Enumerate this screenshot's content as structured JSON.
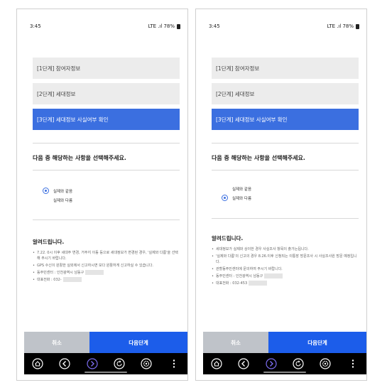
{
  "screens": [
    {
      "id": "left",
      "status": {
        "time": "3:45",
        "signal": "LTE .ıl",
        "battery": "78%"
      },
      "steps": [
        {
          "label": "[1단계] 참여자정보",
          "active": false
        },
        {
          "label": "[2단계] 세대정보",
          "active": false
        },
        {
          "label": "[3단계] 세대정보 사실여부 확인",
          "active": true
        }
      ],
      "question": "다음 중 해당하는 사항을 선택해주세요.",
      "options": [
        {
          "label": "실제와 같음",
          "checked": true
        },
        {
          "label": "실제와 다름",
          "checked": false
        }
      ],
      "notice_title": "알려드립니다.",
      "notice_items": [
        "7.22. 0시 이후 세대주 변경, 거주지 이동 등으로 세대정보가 변경된 경우, '실제와 다름'을 선택해 주시기 바랍니다.",
        "GPS 수신이 원활한 실외에서 신고하시면 보다 원활하게 신고하실 수 있습니다.",
        "동주민센터 : 인천광역시 남동구",
        "대표전화 : 032-"
      ],
      "buttons": {
        "cancel": "취소",
        "next": "다음단계"
      }
    },
    {
      "id": "right",
      "status": {
        "time": "3:45",
        "signal": "LTE .ıl",
        "battery": "78%"
      },
      "steps": [
        {
          "label": "[1단계] 참여자정보",
          "active": false
        },
        {
          "label": "[2단계] 세대정보",
          "active": false
        },
        {
          "label": "[3단계] 세대정보 사실여부 확인",
          "active": true
        }
      ],
      "question": "다음 중 해당하는 사항을 선택해주세요.",
      "options": [
        {
          "label": "실제와 같음",
          "checked": false
        },
        {
          "label": "실제와 다름",
          "checked": true
        }
      ],
      "notice_title": "알려드립니다.",
      "notice_items": [
        "세대정보가 실제와 상이한 경우 사실조사 항목이 출가는됩니다.",
        "'실제와 다름'의 신고의 경우 8.26.이후 신청되는 이통장 방문조사 시 사실조사원 방문 예정입니다.",
        "관할동주민센터에 문의하여 주시기 바랍니다.",
        "동주민센터 : 인천광역시 남동구",
        "대표전화 : 032-453"
      ],
      "buttons": {
        "cancel": "취소",
        "next": "다음단계"
      }
    }
  ],
  "colors": {
    "accent": "#3b6fe0",
    "next_button": "#1c5dea",
    "cancel_button": "#bfc3c9"
  },
  "nav_icons": [
    "home-icon",
    "back-icon",
    "forward-icon",
    "refresh-icon",
    "settings-icon",
    "more-icon"
  ]
}
